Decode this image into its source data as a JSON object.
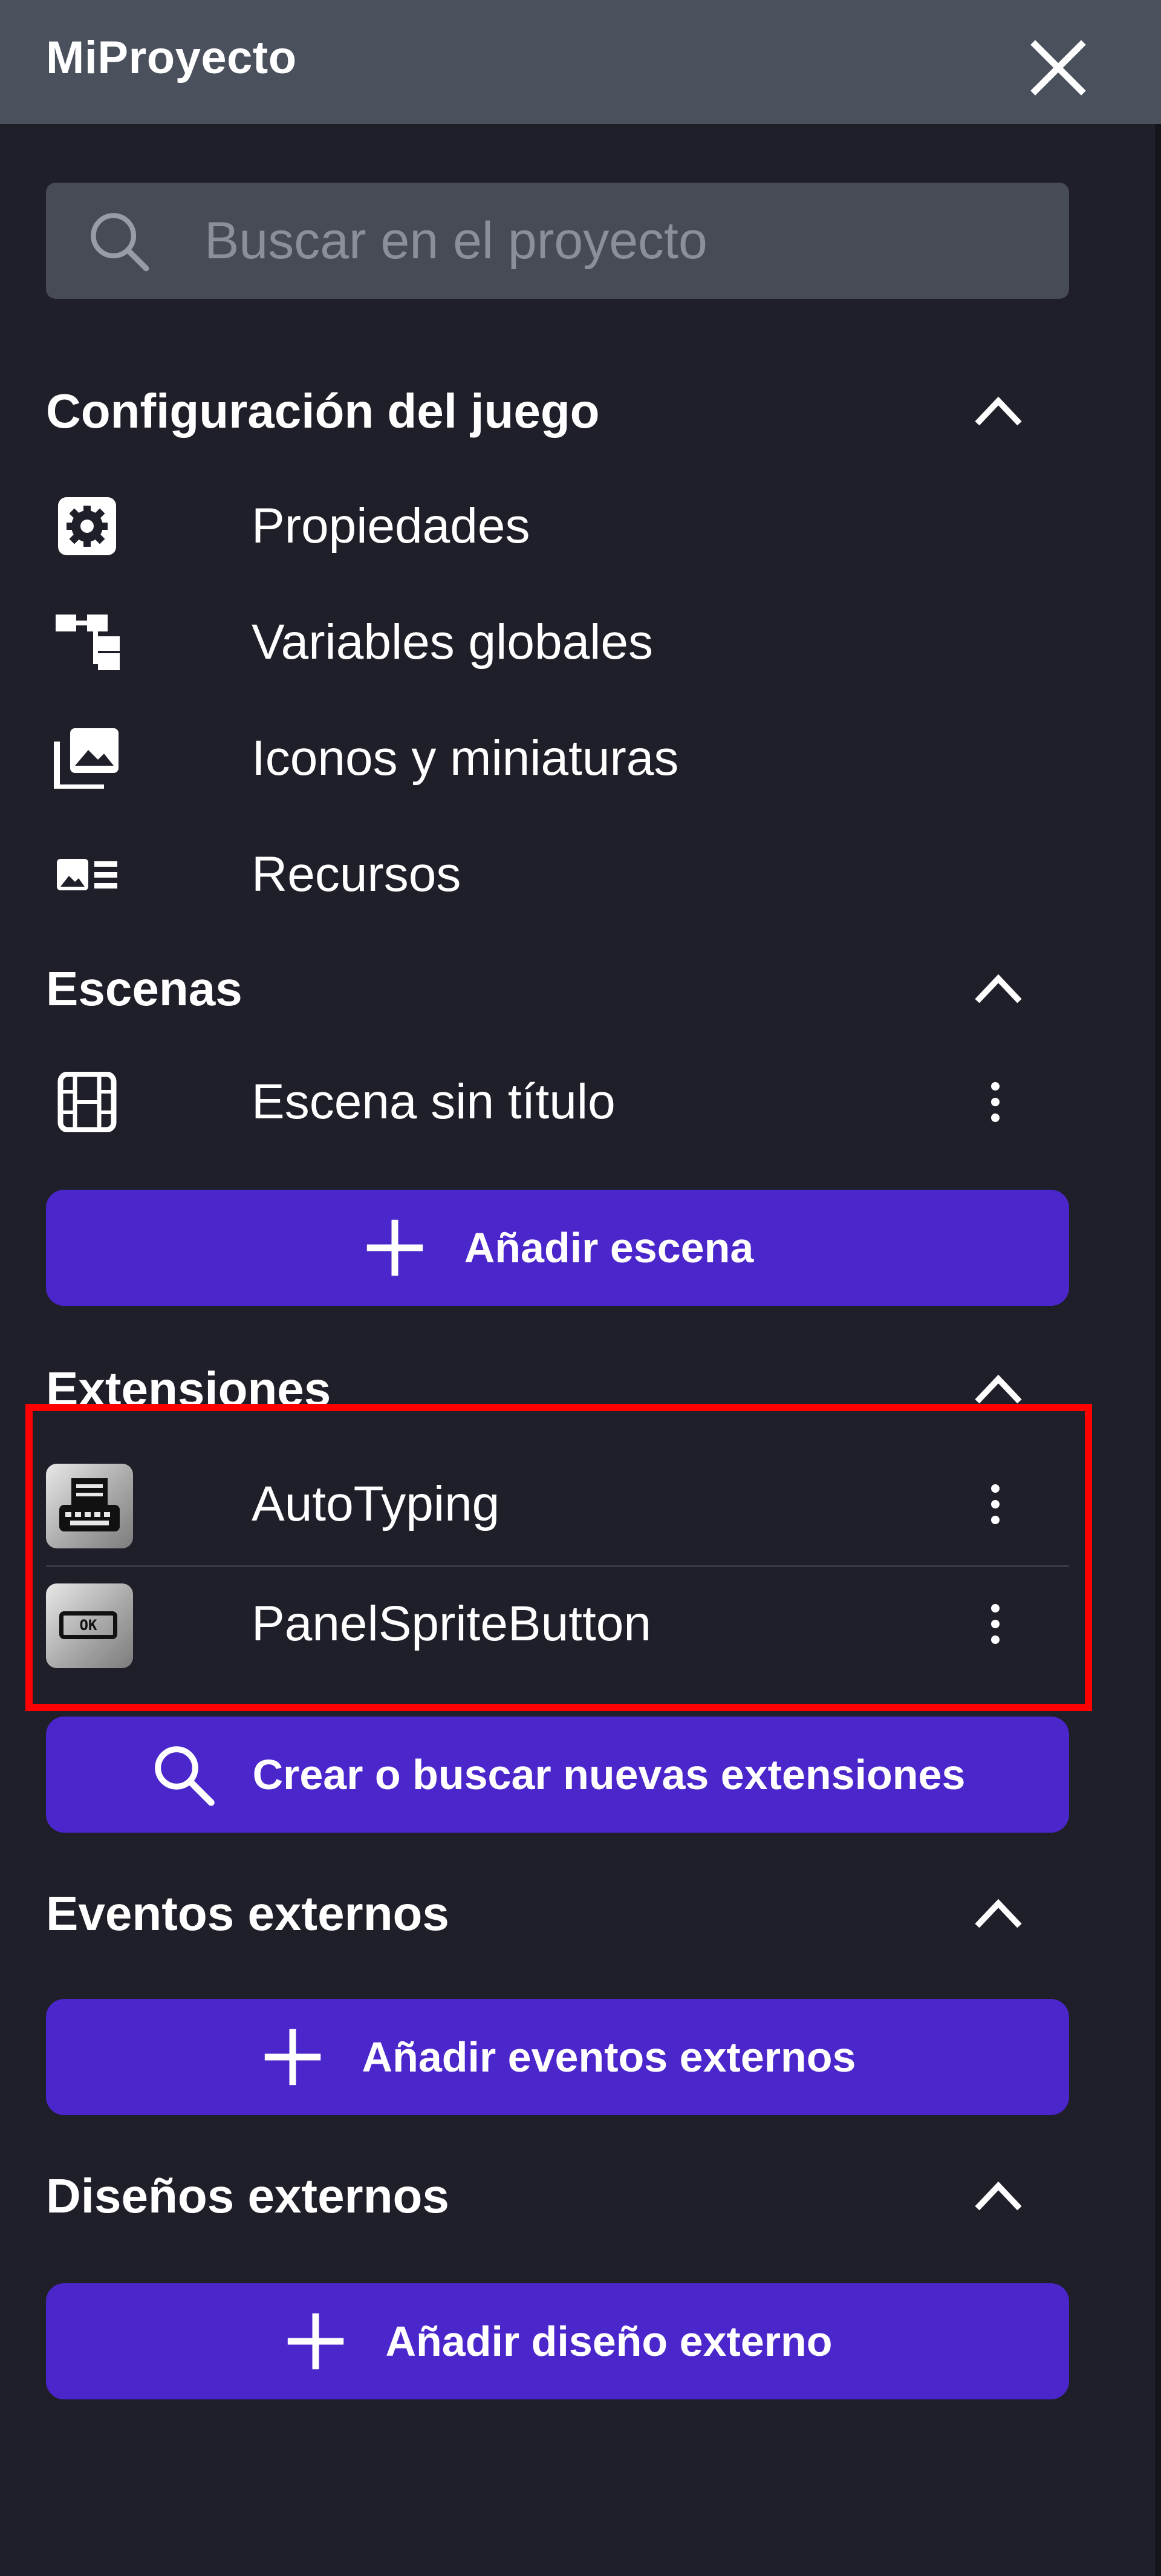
{
  "header": {
    "title": "MiProyecto",
    "close_icon": "close-icon"
  },
  "search": {
    "placeholder": "Buscar en el proyecto",
    "value": ""
  },
  "sections": {
    "game_config": {
      "title": "Configuración del juego",
      "items": [
        {
          "label": "Propiedades",
          "icon": "gear-icon"
        },
        {
          "label": "Variables globales",
          "icon": "variables-tree-icon"
        },
        {
          "label": "Iconos y miniaturas",
          "icon": "image-gallery-icon"
        },
        {
          "label": "Recursos",
          "icon": "resources-list-icon"
        }
      ]
    },
    "scenes": {
      "title": "Escenas",
      "items": [
        {
          "label": "Escena sin título",
          "icon": "film-icon"
        }
      ],
      "add_button": "Añadir escena"
    },
    "extensions": {
      "title": "Extensiones",
      "items": [
        {
          "label": "AutoTyping",
          "icon": "typewriter-icon"
        },
        {
          "label": "PanelSpriteButton",
          "icon": "ok-button-icon",
          "icon_text": "OK"
        }
      ],
      "add_button": "Crear o buscar nuevas extensiones"
    },
    "external_events": {
      "title": "Eventos externos",
      "add_button": "Añadir eventos externos"
    },
    "external_layouts": {
      "title": "Diseños externos",
      "add_button": "Añadir diseño externo"
    }
  },
  "colors": {
    "background": "#1f1f29",
    "header": "#4a515c",
    "accent_button": "#4a26cb",
    "highlight": "#ff0000"
  }
}
